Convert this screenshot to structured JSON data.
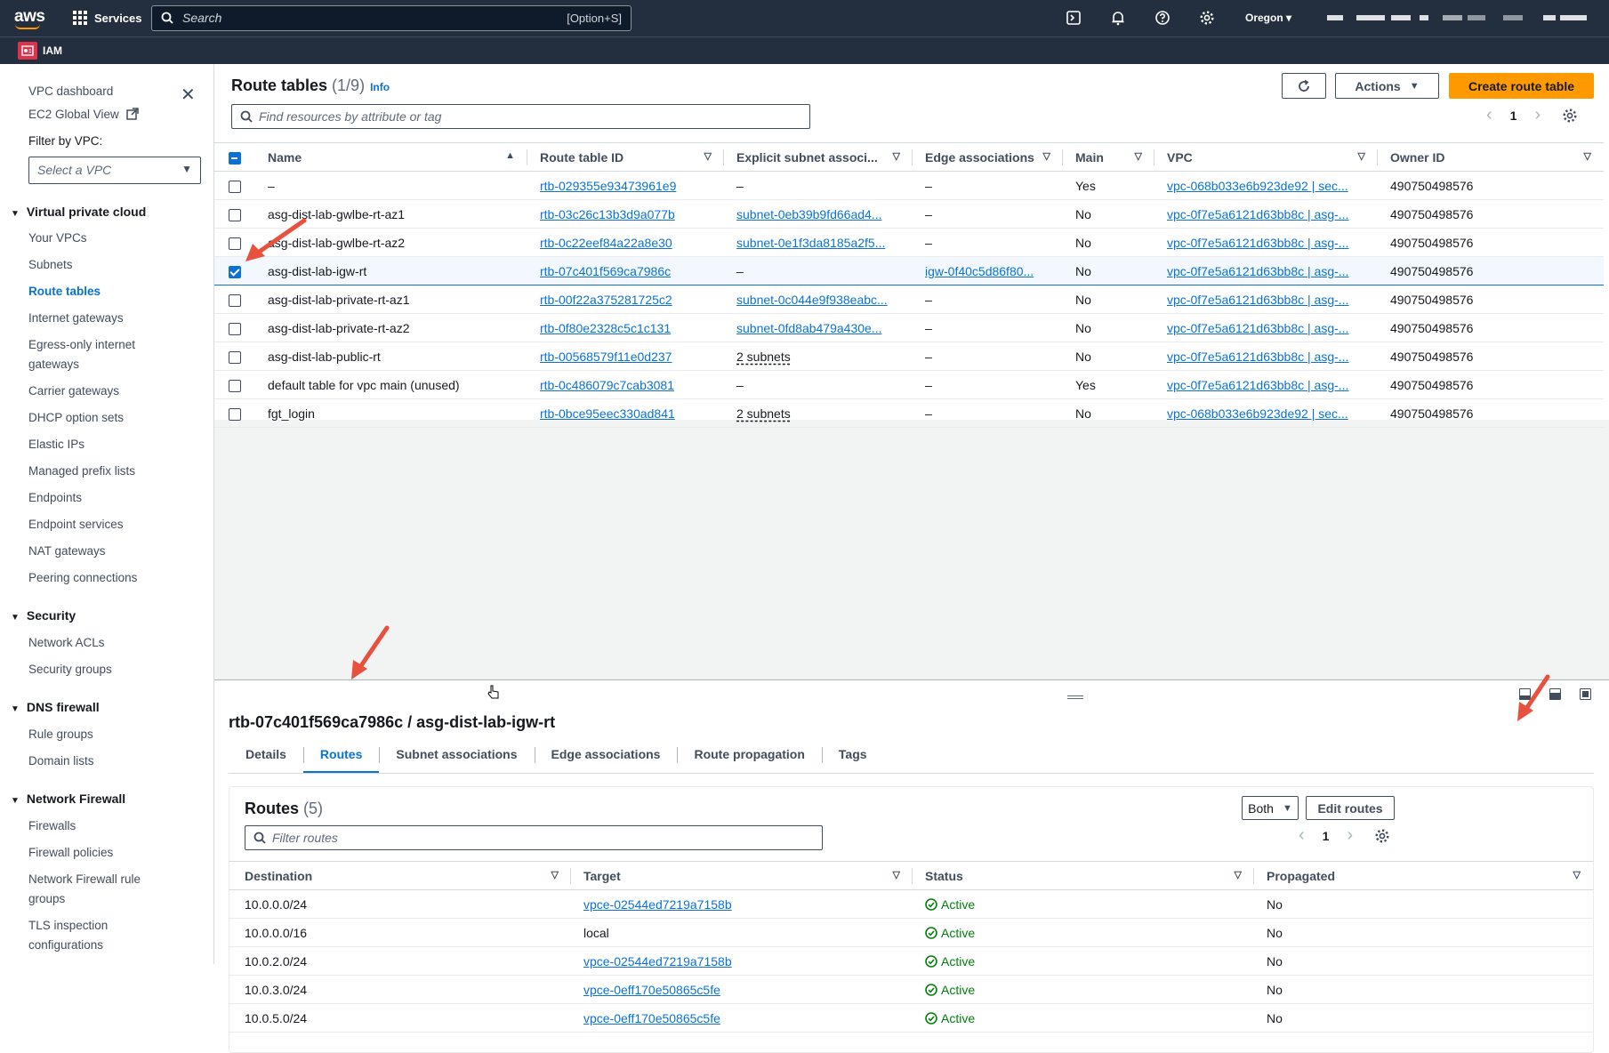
{
  "topnav": {
    "logo": "aws",
    "services_label": "Services",
    "search_placeholder": "Search",
    "search_shortcut": "[Option+S]",
    "region": "Oregon",
    "service_badge": "IAM"
  },
  "sidebar": {
    "items_top": [
      "VPC dashboard",
      "EC2 Global View"
    ],
    "filter_label": "Filter by VPC:",
    "filter_placeholder": "Select a VPC",
    "sections": [
      {
        "title": "Virtual private cloud",
        "items": [
          "Your VPCs",
          "Subnets",
          "Route tables",
          "Internet gateways",
          "Egress-only internet",
          "gateways",
          "Carrier gateways",
          "DHCP option sets",
          "Elastic IPs",
          "Managed prefix lists",
          "Endpoints",
          "Endpoint services",
          "NAT gateways",
          "Peering connections"
        ]
      },
      {
        "title": "Security",
        "items": [
          "Network ACLs",
          "Security groups"
        ]
      },
      {
        "title": "DNS firewall",
        "items": [
          "Rule groups",
          "Domain lists"
        ]
      },
      {
        "title": "Network Firewall",
        "items": [
          "Firewalls",
          "Firewall policies",
          "Network Firewall rule",
          "groups",
          "TLS inspection",
          "configurations"
        ]
      }
    ]
  },
  "route_tables": {
    "title": "Route tables",
    "count": "(1/9)",
    "info": "Info",
    "actions_label": "Actions",
    "create_label": "Create route table",
    "filter_placeholder": "Find resources by attribute or tag",
    "page": "1",
    "columns": [
      "Name",
      "Route table ID",
      "Explicit subnet associ...",
      "Edge associations",
      "Main",
      "VPC",
      "Owner ID"
    ],
    "rows": [
      {
        "name": "–",
        "id": "rtb-029355e93473961e9",
        "subnet": "–",
        "subnet_type": "text",
        "edge": "–",
        "main": "Yes",
        "vpc": "vpc-068b033e6b923de92 | sec...",
        "owner": "490750498576",
        "selected": false
      },
      {
        "name": "asg-dist-lab-gwlbe-rt-az1",
        "id": "rtb-03c26c13b3d9a077b",
        "subnet": "subnet-0eb39b9fd66ad4...",
        "subnet_type": "link",
        "edge": "–",
        "main": "No",
        "vpc": "vpc-0f7e5a6121d63bb8c | asg-...",
        "owner": "490750498576",
        "selected": false
      },
      {
        "name": "asg-dist-lab-gwlbe-rt-az2",
        "id": "rtb-0c22eef84a22a8e30",
        "subnet": "subnet-0e1f3da8185a2f5...",
        "subnet_type": "link",
        "edge": "–",
        "main": "No",
        "vpc": "vpc-0f7e5a6121d63bb8c | asg-...",
        "owner": "490750498576",
        "selected": false
      },
      {
        "name": "asg-dist-lab-igw-rt",
        "id": "rtb-07c401f569ca7986c",
        "subnet": "–",
        "subnet_type": "text",
        "edge": "igw-0f40c5d86f80...",
        "main": "No",
        "vpc": "vpc-0f7e5a6121d63bb8c | asg-...",
        "owner": "490750498576",
        "selected": true
      },
      {
        "name": "asg-dist-lab-private-rt-az1",
        "id": "rtb-00f22a375281725c2",
        "subnet": "subnet-0c044e9f938eabc...",
        "subnet_type": "link",
        "edge": "–",
        "main": "No",
        "vpc": "vpc-0f7e5a6121d63bb8c | asg-...",
        "owner": "490750498576",
        "selected": false
      },
      {
        "name": "asg-dist-lab-private-rt-az2",
        "id": "rtb-0f80e2328c5c1c131",
        "subnet": "subnet-0fd8ab479a430e...",
        "subnet_type": "link",
        "edge": "–",
        "main": "No",
        "vpc": "vpc-0f7e5a6121d63bb8c | asg-...",
        "owner": "490750498576",
        "selected": false
      },
      {
        "name": "asg-dist-lab-public-rt",
        "id": "rtb-00568579f11e0d237",
        "subnet": "2 subnets",
        "subnet_type": "dotted",
        "edge": "–",
        "main": "No",
        "vpc": "vpc-0f7e5a6121d63bb8c | asg-...",
        "owner": "490750498576",
        "selected": false
      },
      {
        "name": "default table for vpc main (unused)",
        "id": "rtb-0c486079c7cab3081",
        "subnet": "–",
        "subnet_type": "text",
        "edge": "–",
        "main": "Yes",
        "vpc": "vpc-0f7e5a6121d63bb8c | asg-...",
        "owner": "490750498576",
        "selected": false
      },
      {
        "name": "fgt_login",
        "id": "rtb-0bce95eec330ad841",
        "subnet": "2 subnets",
        "subnet_type": "dotted",
        "edge": "–",
        "main": "No",
        "vpc": "vpc-068b033e6b923de92 | sec...",
        "owner": "490750498576",
        "selected": false
      }
    ]
  },
  "detail": {
    "title": "rtb-07c401f569ca7986c / asg-dist-lab-igw-rt",
    "tabs": [
      "Details",
      "Routes",
      "Subnet associations",
      "Edge associations",
      "Route propagation",
      "Tags"
    ],
    "active_tab": "Routes",
    "routes": {
      "title": "Routes",
      "count": "(5)",
      "both_label": "Both",
      "edit_label": "Edit routes",
      "filter_placeholder": "Filter routes",
      "page": "1",
      "columns": [
        "Destination",
        "Target",
        "Status",
        "Propagated"
      ],
      "rows": [
        {
          "destination": "10.0.0.0/24",
          "target": "vpce-02544ed7219a7158b",
          "target_link": true,
          "status": "Active",
          "propagated": "No"
        },
        {
          "destination": "10.0.0.0/16",
          "target": "local",
          "target_link": false,
          "status": "Active",
          "propagated": "No"
        },
        {
          "destination": "10.0.2.0/24",
          "target": "vpce-02544ed7219a7158b",
          "target_link": true,
          "status": "Active",
          "propagated": "No"
        },
        {
          "destination": "10.0.3.0/24",
          "target": "vpce-0eff170e50865c5fe",
          "target_link": true,
          "status": "Active",
          "propagated": "No"
        },
        {
          "destination": "10.0.5.0/24",
          "target": "vpce-0eff170e50865c5fe",
          "target_link": true,
          "status": "Active",
          "propagated": "No"
        }
      ]
    }
  },
  "colors": {
    "nav": "#232f3e",
    "link": "#0972d3",
    "primary": "#ff9900",
    "success": "#037f0c",
    "annotation": "#e8513d"
  }
}
